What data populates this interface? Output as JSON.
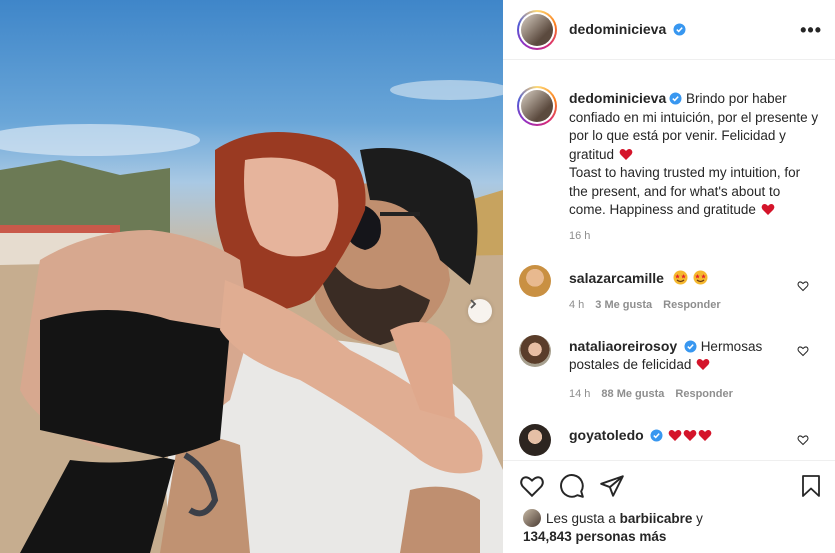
{
  "post": {
    "author": "dedominicieva",
    "more_label": "•••",
    "caption_text": "Brindo por haber confiado en mi intuición, por el presente y por lo que está por venir. Felicidad y gratitud",
    "caption_text_en": "Toast to having trusted my intuition, for the present, and for what's about to come. Happiness and gratitude",
    "time": "16 h"
  },
  "comments": [
    {
      "user": "salazarcamille",
      "verified": false,
      "text": "",
      "time": "4 h",
      "likes": "3 Me gusta",
      "reply": "Responder"
    },
    {
      "user": "nataliaoreirosoy",
      "verified": true,
      "text": "Hermosas postales de felicidad",
      "time": "14 h",
      "likes": "88 Me gusta",
      "reply": "Responder"
    },
    {
      "user": "goyatoledo",
      "verified": true,
      "text": ""
    }
  ],
  "likes": {
    "prefix": "Les gusta a",
    "user": "barbiicabre",
    "joiner": "y",
    "count": "134,843 personas más"
  },
  "colors": {
    "verified": "#3897f0",
    "heart_red": "#ed4956",
    "muted": "#8e8e8e"
  },
  "icons": [
    "next-arrow-icon",
    "verified-icon",
    "heart-icon",
    "comment-icon",
    "share-icon",
    "bookmark-icon",
    "emoji-star-eyes-icon",
    "red-heart-emoji-icon"
  ]
}
